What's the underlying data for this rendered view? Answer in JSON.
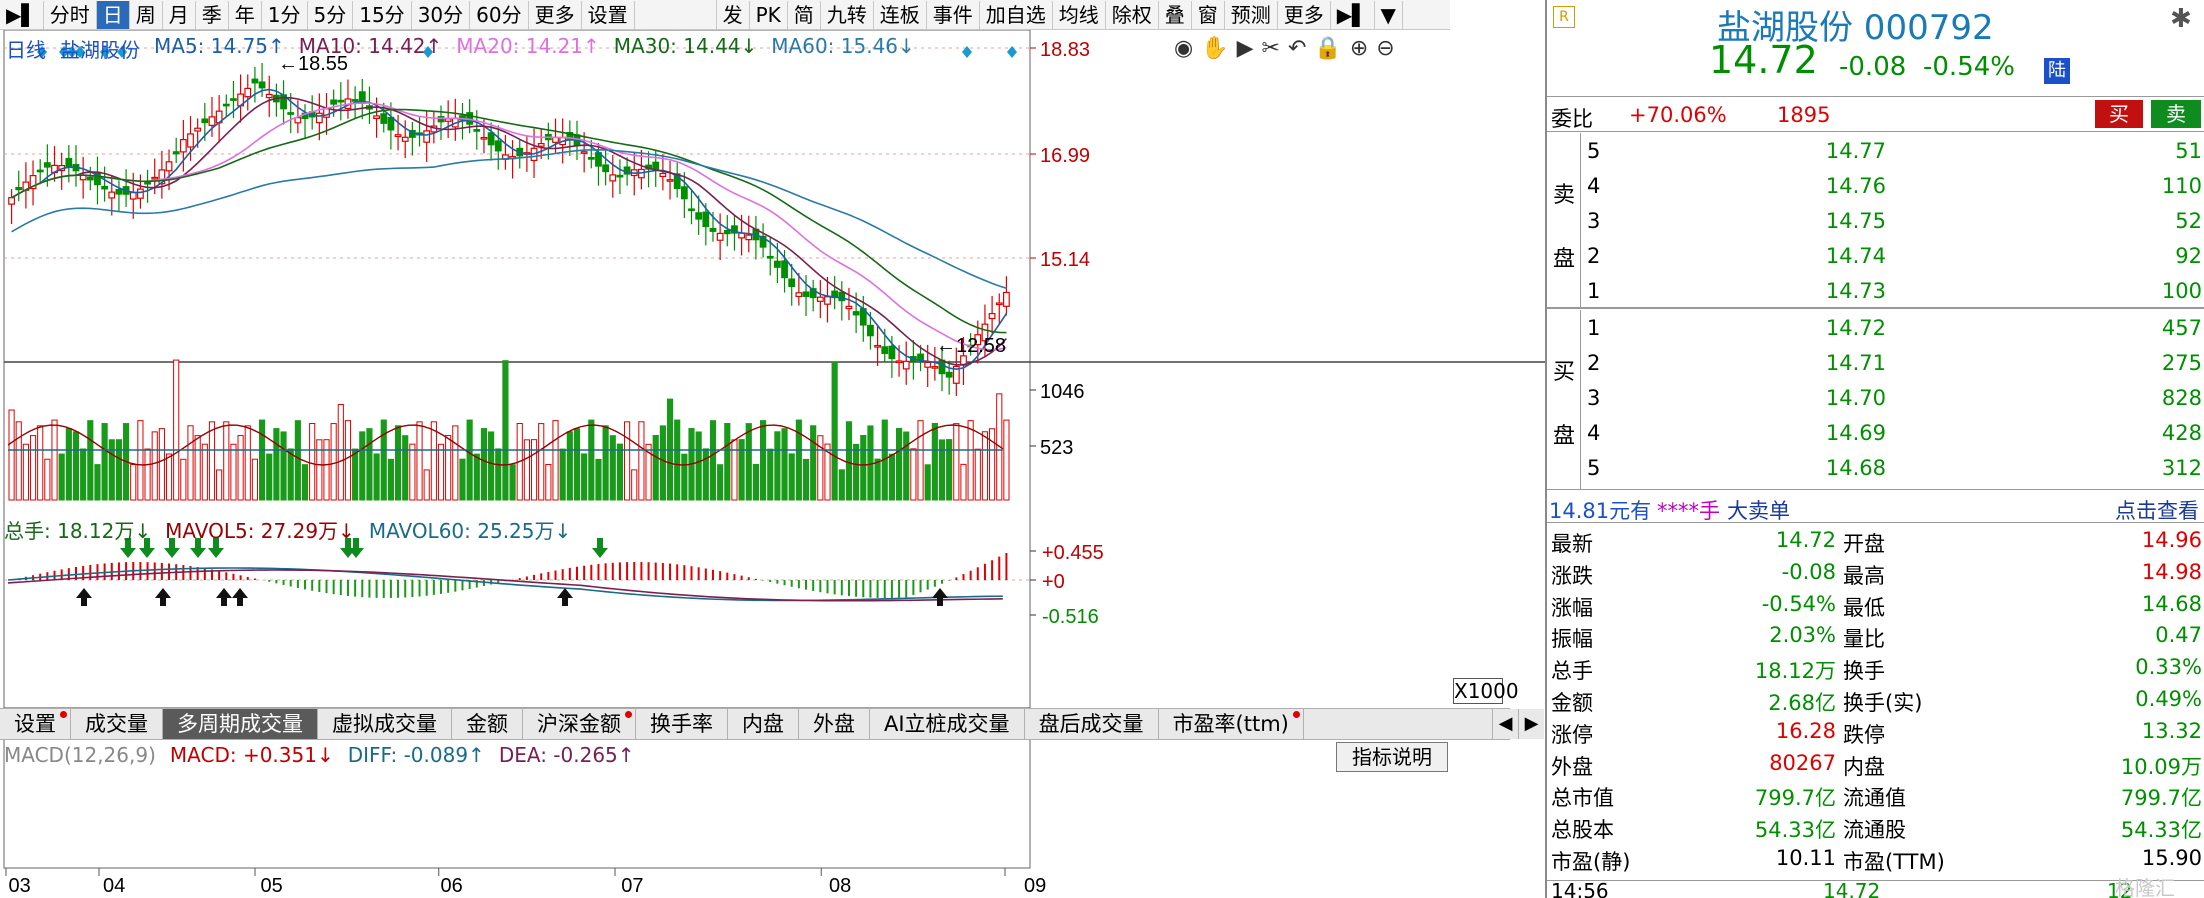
{
  "toolbar": {
    "left_items": [
      "分时",
      "日",
      "周",
      "月",
      "季",
      "年",
      "1分",
      "5分",
      "15分",
      "30分",
      "60分",
      "更多",
      "设置"
    ],
    "active": "日",
    "right_items": [
      "发",
      "PK",
      "简",
      "九转",
      "连板",
      "事件",
      "加自选",
      "均线",
      "除权",
      "叠",
      "窗",
      "预测",
      "更多"
    ]
  },
  "chart": {
    "period": "日线",
    "stock": "盐湖股份",
    "ma": [
      {
        "label": "MA5: 14.75↑",
        "color": "#1a5fa8"
      },
      {
        "label": "MA10: 14.42↑",
        "color": "#7a2050"
      },
      {
        "label": "MA20: 14.21↑",
        "color": "#e070e0"
      },
      {
        "label": "MA30: 14.44↓",
        "color": "#156a15"
      },
      {
        "label": "MA60: 15.46↓",
        "color": "#2a7aa8"
      }
    ],
    "price_ticks": [
      "18.83",
      "16.99",
      "15.14"
    ],
    "high_label": "18.55",
    "low_label": "12.58",
    "vol_legend": [
      {
        "label": "总手: 18.12万↓",
        "color": "#156a15"
      },
      {
        "label": "MAVOL5: 27.29万↓",
        "color": "#9a0000"
      },
      {
        "label": "MAVOL60: 25.25万↓",
        "color": "#1a6a8a"
      }
    ],
    "vol_ticks": [
      "1046",
      "523"
    ],
    "vol_unit": "X1000",
    "macd_legend": [
      {
        "label": "MACD(12,26,9)",
        "color": "#888888"
      },
      {
        "label": "MACD: +0.351↓",
        "color": "#c00000"
      },
      {
        "label": "DIFF: -0.089↑",
        "color": "#1a6a8a"
      },
      {
        "label": "DEA: -0.265↑",
        "color": "#7a2050"
      }
    ],
    "macd_ticks": [
      "+0.455",
      "+0",
      "-0.516"
    ],
    "indicator_help": "指标说明",
    "months": [
      "03",
      "04",
      "05",
      "06",
      "07",
      "08",
      "09"
    ],
    "toolbar_icons": [
      "eye-icon",
      "hand-icon",
      "play-icon",
      "scissors-icon",
      "undo-icon",
      "lock-icon",
      "zoom-in-icon",
      "zoom-out-icon"
    ]
  },
  "tabs": [
    "设置",
    "成交量",
    "多周期成交量",
    "虚拟成交量",
    "金额",
    "沪深金额",
    "换手率",
    "内盘",
    "外盘",
    "AI立桩成交量",
    "盘后成交量",
    "市盈率(ttm)"
  ],
  "tabs_active": "多周期成交量",
  "tabs_dots": [
    "设置",
    "沪深金额",
    "市盈率(ttm)"
  ],
  "quote": {
    "badge": "R",
    "name_code": "盐湖股份 000792",
    "price": "14.72",
    "change": "-0.08",
    "change_pct": "-0.54%",
    "exchange_tag": "陆",
    "webi_label": "委比",
    "webi_value": "+70.06%",
    "webi_diff": "1895",
    "buy_btn": "买",
    "sell_btn": "卖",
    "sell_side_label": [
      "卖",
      "盘"
    ],
    "buy_side_label": [
      "买",
      "盘"
    ],
    "asks": [
      {
        "level": "5",
        "price": "14.77",
        "vol": "51"
      },
      {
        "level": "4",
        "price": "14.76",
        "vol": "110"
      },
      {
        "level": "3",
        "price": "14.75",
        "vol": "52"
      },
      {
        "level": "2",
        "price": "14.74",
        "vol": "92"
      },
      {
        "level": "1",
        "price": "14.73",
        "vol": "100"
      }
    ],
    "bids": [
      {
        "level": "1",
        "price": "14.72",
        "vol": "457"
      },
      {
        "level": "2",
        "price": "14.71",
        "vol": "275"
      },
      {
        "level": "3",
        "price": "14.70",
        "vol": "828"
      },
      {
        "level": "4",
        "price": "14.69",
        "vol": "428"
      },
      {
        "level": "5",
        "price": "14.68",
        "vol": "312"
      }
    ],
    "bigorder": {
      "price": "14.81元有",
      "hands": "****手",
      "label": "大卖单",
      "link": "点击查看"
    },
    "stats": [
      {
        "l": "最新",
        "v": "14.72",
        "vc": "green",
        "l2": "开盘",
        "v2": "14.96",
        "v2c": "red"
      },
      {
        "l": "涨跌",
        "v": "-0.08",
        "vc": "green",
        "l2": "最高",
        "v2": "14.98",
        "v2c": "red"
      },
      {
        "l": "涨幅",
        "v": "-0.54%",
        "vc": "green",
        "l2": "最低",
        "v2": "14.68",
        "v2c": "green"
      },
      {
        "l": "振幅",
        "v": "2.03%",
        "vc": "green",
        "l2": "量比",
        "v2": "0.47",
        "v2c": "green"
      },
      {
        "l": "总手",
        "v": "18.12万",
        "vc": "green",
        "l2": "换手",
        "v2": "0.33%",
        "v2c": "green"
      },
      {
        "l": "金额",
        "v": "2.68亿",
        "vc": "green",
        "l2": "换手(实)",
        "v2": "0.49%",
        "v2c": "green"
      },
      {
        "l": "涨停",
        "v": "16.28",
        "vc": "red",
        "l2": "跌停",
        "v2": "13.32",
        "v2c": "green"
      },
      {
        "l": "外盘",
        "v": "80267",
        "vc": "red",
        "l2": "内盘",
        "v2": "10.09万",
        "v2c": "green"
      },
      {
        "l": "总市值",
        "v": "799.7亿",
        "vc": "green",
        "l2": "流通值",
        "v2": "799.7亿",
        "v2c": "green"
      },
      {
        "l": "总股本",
        "v": "54.33亿",
        "vc": "green",
        "l2": "流通股",
        "v2": "54.33亿",
        "v2c": "green"
      },
      {
        "l": "市盈(静)",
        "v": "10.11",
        "vc": "black",
        "l2": "市盈(TTM)",
        "v2": "15.90",
        "v2c": "black"
      }
    ],
    "tick_time": "14:56",
    "tick_price": "14.72",
    "tick_vol": "12"
  },
  "watermark": "格隆汇",
  "colors": {
    "up": "#e00000",
    "down": "#008f00",
    "ma5": "#1a5fa8",
    "ma10": "#7a2050",
    "ma20": "#e070e0",
    "ma30": "#156a15",
    "ma60": "#2a7aa8"
  }
}
